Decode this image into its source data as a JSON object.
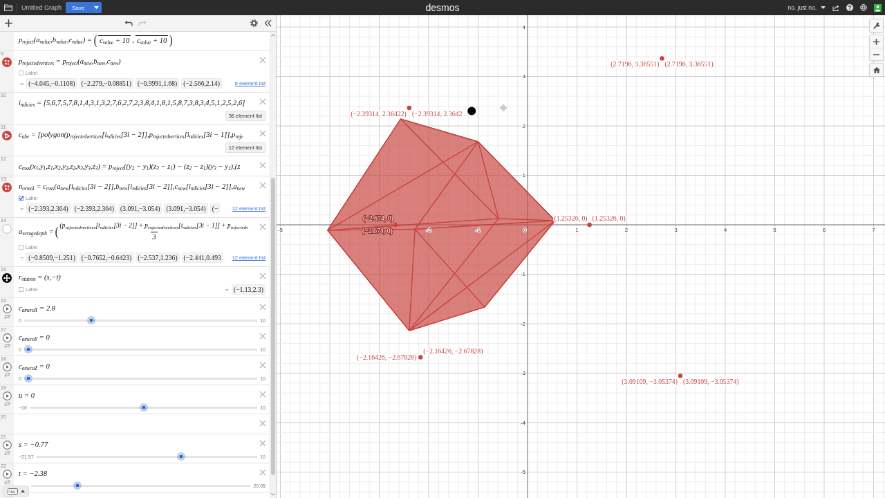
{
  "topbar": {
    "title": "Untitled Graph",
    "save": "Save",
    "brand": "desmos",
    "user": "no. just no."
  },
  "expressions": [
    {
      "kind": "partial",
      "math": [
        {
          "kind": "text",
          "text": "p$_{roject}$(a$_{value}$,b$_{value}$,c$_{value}$) = "
        },
        {
          "kind": "big",
          "text": "("
        },
        {
          "kind": "frac",
          "den": "c$_{value}$ + 10"
        },
        {
          "kind": "text",
          "text": ","
        },
        {
          "kind": "frac",
          "den": "c$_{value}$ + 10"
        },
        {
          "kind": "big",
          "text": ")"
        }
      ]
    },
    {
      "kind": "points",
      "number": "9",
      "math": [
        {
          "kind": "text",
          "text": "p$_{rojectedvertices}$ = p$_{roject}$(a$_{new}$,b$_{new}$,c$_{new}$)"
        }
      ],
      "label": {
        "text": "Label",
        "checked": false
      },
      "values": {
        "equals": "=",
        "items": [
          "(−4.045,−0.1108)",
          "(−2.279,−0.08851)",
          "(−0.9991,1.68)",
          "(−2.566,2.14)"
        ],
        "link": "8 element list"
      }
    },
    {
      "kind": "plain",
      "number": "10",
      "math": [
        {
          "kind": "text",
          "text": "i$_{ndicies}$ = [5,6,7,5,7,8,1,4,3,1,3,2,7,6,2,7,2,3,8,4,1,8,1,5,8,7,3,8,3,4,5,1,2,5,2,6]"
        }
      ],
      "list_button": "36 element list"
    },
    {
      "kind": "polygon",
      "number": "11",
      "math": [
        {
          "kind": "text",
          "text": "c$_{ube}$ = [polygon(p$_{rojectedvertices}$[i$_{ndicies}$[3i − 2]],p$_{rojectedvertices}$[i$_{ndicies}$[3i − 1]],p$_{roje}$"
        }
      ],
      "list_button": "12 element list"
    },
    {
      "kind": "plain",
      "number": "12",
      "math": [
        {
          "kind": "text",
          "text": "c$_{ross}$(x$_{1}$,y$_{1}$,z$_{1}$,x$_{2}$,y$_{2}$,z$_{2}$,x$_{3}$,y$_{3}$,z$_{3}$) = p$_{roject}$((y$_{2}$ − y$_{1}$)(z$_{3}$ − z$_{1}$) − (z$_{2}$ − z$_{1}$)(y$_{3}$ − y$_{1}$),(z"
        }
      ]
    },
    {
      "kind": "points",
      "number": "13",
      "math": [
        {
          "kind": "text",
          "text": "n$_{ormal}$ = c$_{ross}$(a$_{new}$[i$_{ndicies}$[3i − 2]],b$_{new}$[i$_{ndicies}$[3i − 2]],c$_{new}$[i$_{ndicies}$[3i − 2]],a$_{new}$"
        }
      ],
      "label": {
        "text": "Label",
        "checked": true
      },
      "values": {
        "equals": "=",
        "items": [
          "(−2.393,2.364)",
          "(−2.393,2.364)",
          "(3.091,−3.054)",
          "(3.091,−3.054)",
          "(−"
        ],
        "link": "12 element list"
      }
    },
    {
      "kind": "hidden",
      "number": "14",
      "math": [
        {
          "kind": "text",
          "text": "a$_{veragedepth}$ = "
        },
        {
          "kind": "big",
          "text": "("
        },
        {
          "kind": "frac",
          "num": "(p$_{rojectedvertices}$[i$_{ndicies}$[3i − 2]] + p$_{rojectedvertices}$[i$_{ndicies}$[3i − 1]] + p$_{rojectedv}$",
          "den": "3"
        }
      ],
      "label": {
        "text": "Label",
        "checked": false
      },
      "values": {
        "equals": "=",
        "items": [
          "(−0.8509,−1.251)",
          "(−0.7652,−0.6423)",
          "(−2.537,1.236)",
          "(−2.441,0.493"
        ],
        "link": "12 element list"
      }
    },
    {
      "kind": "point-drag",
      "number": "15",
      "math": [
        {
          "kind": "text",
          "text": "r$_{otation}$ = (s,−t)"
        }
      ],
      "label": {
        "text": "Label",
        "checked": false
      },
      "result": {
        "equals": "=",
        "value": "(−1.13,2.3)"
      }
    },
    {
      "kind": "slider",
      "number": "16",
      "math": [
        {
          "kind": "text",
          "text": "c$_{ameraX}$ = 2.8"
        }
      ],
      "slider": {
        "min": "0",
        "max": "10",
        "level": 0.28
      }
    },
    {
      "kind": "slider",
      "number": "17",
      "math": [
        {
          "kind": "text",
          "text": "c$_{ameraY}$ = 0"
        }
      ],
      "slider": {
        "min": "0",
        "max": "10",
        "level": 0
      }
    },
    {
      "kind": "slider",
      "number": "18",
      "math": [
        {
          "kind": "text",
          "text": "c$_{ameraZ}$ = 0"
        }
      ],
      "slider": {
        "min": "0",
        "max": "10",
        "level": 0
      }
    },
    {
      "kind": "slider",
      "number": "19",
      "math": [
        {
          "kind": "text",
          "text": "u = 0"
        }
      ],
      "slider": {
        "min": "−10",
        "max": "10",
        "level": 0.5
      }
    },
    {
      "kind": "empty",
      "number": "20"
    },
    {
      "kind": "slider",
      "number": "21",
      "math": [
        {
          "kind": "text",
          "text": "s = −0.77"
        }
      ],
      "slider": {
        "min": "−21.57",
        "max": "10",
        "level": 0.66
      }
    },
    {
      "kind": "slider",
      "number": "22",
      "math": [
        {
          "kind": "text",
          "text": "t = −2.38"
        }
      ],
      "slider": {
        "max": "29.05",
        "level": 0.2
      }
    }
  ],
  "graph": {
    "chart_data": {
      "type": "scatter",
      "grid": true,
      "x": [
        2.7196,
        -2.39314,
        -2.674,
        1.25326,
        -2.16426,
        3.09109,
        -1.13
      ],
      "series": [
        {
          "color": "#c74440",
          "values": [
            3.36551,
            2.36422,
            0,
            0,
            -2.67828,
            -3.05374,
            null
          ]
        },
        {
          "color": "#000000",
          "values": [
            null,
            null,
            null,
            null,
            null,
            null,
            2.3
          ]
        }
      ],
      "xlim": [
        -5.077,
        7.231
      ],
      "ylim": [
        -5.524,
        4.238
      ],
      "xticks": [
        -5,
        -2,
        -1,
        0,
        1,
        2,
        3,
        4,
        5,
        6,
        7
      ],
      "yticks": [
        -5,
        -4,
        -3,
        -2,
        -1,
        1,
        2,
        3,
        4
      ],
      "annotations": [
        {
          "x": 2.7196,
          "y": 3.36551,
          "text": "(2.7196, 3.36551)"
        },
        {
          "x": 2.7196,
          "y": 3.36551,
          "text": "(2.7196, 3.36551)"
        },
        {
          "x": -2.39314,
          "y": 2.36422,
          "text": "(−2.39314, 2.36422)"
        },
        {
          "x": -2.39314,
          "y": 2.36422,
          "text": "(−2.39314, 2.3642"
        },
        {
          "x": -2.674,
          "y": 0,
          "text": "(−2.674, 0)"
        },
        {
          "x": 1.25326,
          "y": 0,
          "text": "(1.25326, 0)"
        },
        {
          "x": 1.25326,
          "y": 0,
          "text": "(1.25326, 0)"
        },
        {
          "x": -2.674,
          "y": 0,
          "text": "(−2.674, 0)"
        },
        {
          "x": -2.16426,
          "y": -2.67828,
          "text": "(−2.16426, −2.67828)"
        },
        {
          "x": -2.16426,
          "y": -2.67828,
          "text": "(−2.16426, −2.67828)"
        },
        {
          "x": 3.09109,
          "y": -3.05374,
          "text": "(3.09109, −3.05374)"
        },
        {
          "x": 3.09109,
          "y": -3.05374,
          "text": "(3.09109, −3.05374)"
        }
      ]
    }
  }
}
